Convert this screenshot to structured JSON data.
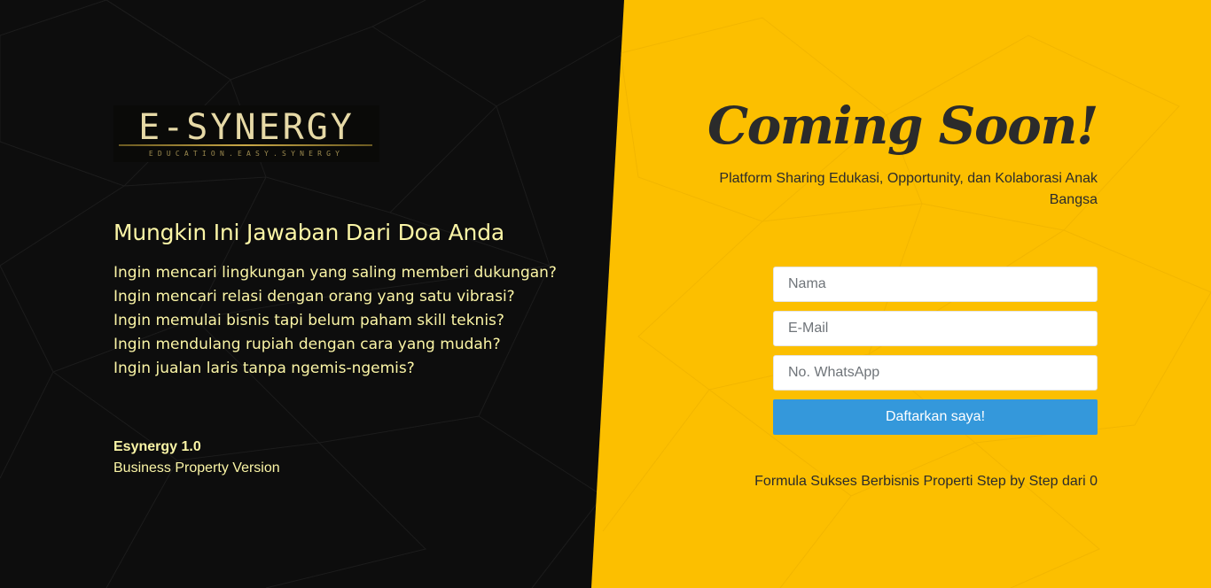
{
  "logo": {
    "main": "E-SYNERGY",
    "sub": "EDUCATION.EASY.SYNERGY"
  },
  "left": {
    "headline": "Mungkin Ini Jawaban Dari Doa Anda",
    "questions": [
      "Ingin mencari lingkungan yang saling memberi dukungan?",
      "Ingin mencari relasi dengan orang yang satu vibrasi?",
      "Ingin memulai bisnis tapi belum paham skill teknis?",
      "Ingin mendulang rupiah dengan cara yang mudah?",
      "Ingin jualan laris tanpa ngemis-ngemis?"
    ],
    "version_title": "Esynergy 1.0",
    "version_sub": "Business Property Version"
  },
  "right": {
    "title": "Coming Soon!",
    "tagline": "Platform Sharing Edukasi, Opportunity, dan Kolaborasi Anak Bangsa",
    "form": {
      "name_placeholder": "Nama",
      "email_placeholder": "E-Mail",
      "whatsapp_placeholder": "No. WhatsApp",
      "submit_label": "Daftarkan saya!"
    },
    "footer_note": "Formula Sukses Berbisnis Properti Step by Step dari 0"
  },
  "colors": {
    "left_bg": "#0d0d0d",
    "right_bg": "#fcbf00",
    "text_light": "#fbf5a6",
    "text_dark": "#2b2b2b",
    "button": "#3498db"
  }
}
